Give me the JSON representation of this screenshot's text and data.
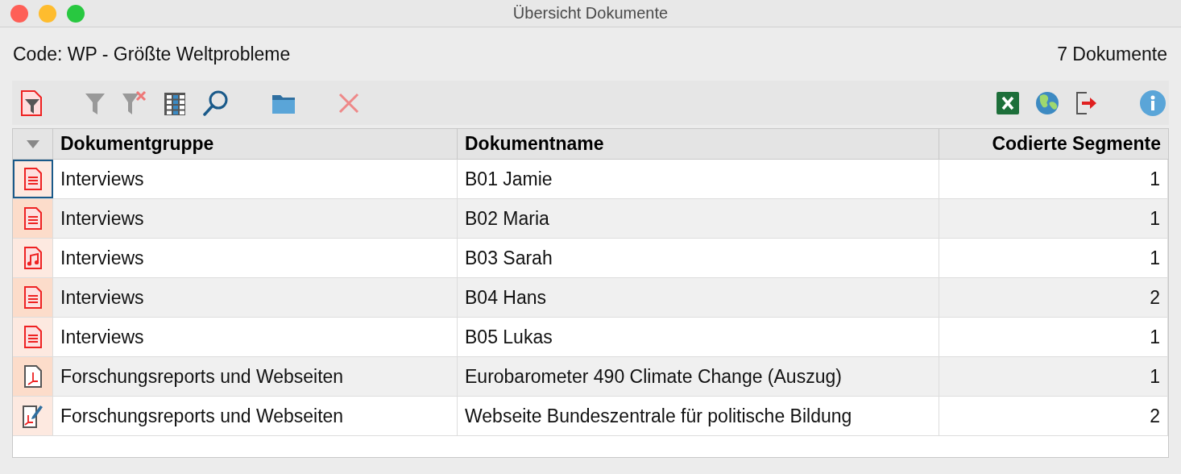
{
  "window": {
    "title": "Übersicht Dokumente"
  },
  "header": {
    "code": "Code: WP - Größte Weltprobleme",
    "count": "7 Dokumente"
  },
  "toolbar": {
    "left": [
      {
        "kind": "doc-filter"
      },
      {
        "kind": "gap"
      },
      {
        "kind": "filter"
      },
      {
        "kind": "filter-clear"
      },
      {
        "kind": "columns"
      },
      {
        "kind": "search"
      },
      {
        "kind": "gap"
      },
      {
        "kind": "folder"
      },
      {
        "kind": "gap"
      },
      {
        "kind": "delete"
      }
    ],
    "right": [
      {
        "kind": "excel"
      },
      {
        "kind": "globe"
      },
      {
        "kind": "export"
      },
      {
        "kind": "gap"
      },
      {
        "kind": "info"
      }
    ]
  },
  "table": {
    "columns": [
      "Dokumentgruppe",
      "Dokumentname",
      "Codierte Segmente"
    ],
    "rows": [
      {
        "kind": "text",
        "focused": true,
        "group": "Interviews",
        "name": "B01 Jamie",
        "segments": "1"
      },
      {
        "kind": "text",
        "focused": false,
        "group": "Interviews",
        "name": "B02 Maria",
        "segments": "1"
      },
      {
        "kind": "audio",
        "focused": false,
        "group": "Interviews",
        "name": "B03 Sarah",
        "segments": "1"
      },
      {
        "kind": "text",
        "focused": false,
        "group": "Interviews",
        "name": "B04 Hans",
        "segments": "2"
      },
      {
        "kind": "text",
        "focused": false,
        "group": "Interviews",
        "name": "B05 Lukas",
        "segments": "1"
      },
      {
        "kind": "pdf",
        "focused": false,
        "group": "Forschungsreports und Webseiten",
        "name": "Eurobarometer 490 Climate Change (Auszug)",
        "segments": "1"
      },
      {
        "kind": "web",
        "focused": false,
        "group": "Forschungsreports und Webseiten",
        "name": "Webseite Bundeszentrale für politische Bildung",
        "segments": "2"
      }
    ]
  }
}
